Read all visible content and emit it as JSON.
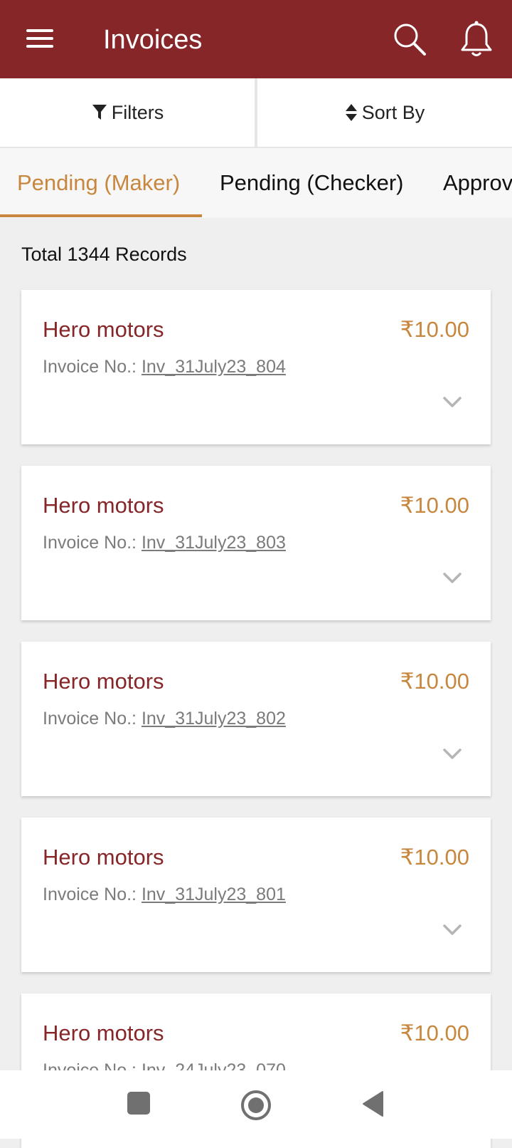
{
  "appbar": {
    "title": "Invoices",
    "icons": [
      "menu-icon",
      "search-icon",
      "bell-icon"
    ]
  },
  "toolbar": {
    "filters_label": "Filters",
    "sort_label": "Sort By"
  },
  "tabs": [
    {
      "label": "Pending (Maker)",
      "selected": true
    },
    {
      "label": "Pending (Checker)",
      "selected": false
    },
    {
      "label": "Approv",
      "selected": false
    }
  ],
  "records_label": "Total 1344 Records",
  "invoices": [
    {
      "name": "Hero motors",
      "amount": "₹10.00",
      "invoice_label": "Invoice No.: ",
      "invoice_no": "Inv_31July23_804"
    },
    {
      "name": "Hero motors",
      "amount": "₹10.00",
      "invoice_label": "Invoice No.: ",
      "invoice_no": "Inv_31July23_803"
    },
    {
      "name": "Hero motors",
      "amount": "₹10.00",
      "invoice_label": "Invoice No.: ",
      "invoice_no": "Inv_31July23_802"
    },
    {
      "name": "Hero motors",
      "amount": "₹10.00",
      "invoice_label": "Invoice No.: ",
      "invoice_no": "Inv_31July23_801"
    },
    {
      "name": "Hero motors",
      "amount": "₹10.00",
      "invoice_label": "Invoice No.: ",
      "invoice_no": "Inv_24July23_070"
    }
  ],
  "colors": {
    "primary": "#862628",
    "accent": "#c8873e",
    "background": "#efefef"
  }
}
